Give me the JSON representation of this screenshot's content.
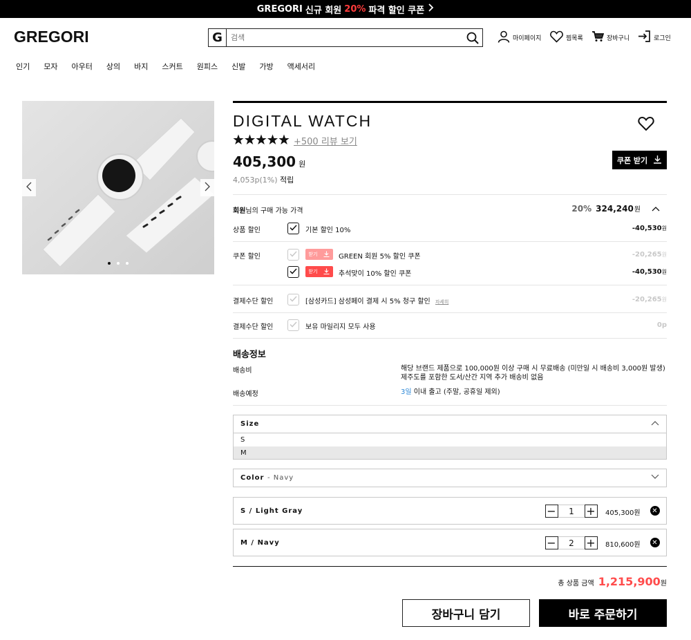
{
  "banner": {
    "brand": "GREGORI",
    "text1": "신규 회원",
    "highlight": "20%",
    "text2": "파격 할인 쿠폰",
    "arrow": ">"
  },
  "header": {
    "logo": "GREGORI",
    "search_badge": "G",
    "search_placeholder": "검색",
    "links": [
      {
        "label": "마이페이지",
        "icon": "user-icon"
      },
      {
        "label": "찜목록",
        "icon": "heart-icon"
      },
      {
        "label": "장바구니",
        "icon": "cart-icon"
      },
      {
        "label": "로그인",
        "icon": "login-icon"
      }
    ]
  },
  "nav": [
    "인기",
    "모자",
    "아우터",
    "상의",
    "바지",
    "스커트",
    "원피스",
    "신발",
    "가방",
    "액세서리"
  ],
  "gallery": {
    "dots": 3,
    "active_dot": 0
  },
  "product": {
    "title": "DIGITAL WATCH",
    "rating": 5,
    "reviews_link": "+500 리뷰 보기",
    "price": "405,300",
    "price_unit": "원",
    "points": "4,053p(1%)",
    "points_suffix": "적립",
    "coupon_button": "쿠폰 받기"
  },
  "member_price": {
    "label_bold": "회원",
    "label_rest": "님의 구매 가능 가격",
    "percent": "20%",
    "price": "324,240",
    "unit": "원"
  },
  "discounts": {
    "product": {
      "label": "상품 할인",
      "desc": "기본 할인 10%",
      "amount": "-40,530",
      "unit": "원"
    },
    "coupon": {
      "label": "쿠폰 할인",
      "tag": "받기",
      "items": [
        {
          "desc": "GREEN 회원 5% 할인 쿠폰",
          "amount": "-20,265",
          "unit": "원",
          "checked": false
        },
        {
          "desc": "추석맞이 10% 할인 쿠폰",
          "amount": "-40,530",
          "unit": "원",
          "checked": true
        }
      ]
    },
    "payment1": {
      "label": "결제수단 할인",
      "desc": "[삼성카드] 삼성페이 결제 시 5% 청구 할인",
      "detail": "자세히",
      "amount": "-20,265",
      "unit": "원"
    },
    "payment2": {
      "label": "결제수단 할인",
      "desc": "보유 마일리지 모두 사용",
      "amount": "0",
      "unit": "p"
    }
  },
  "delivery": {
    "title": "배송정보",
    "fee_label": "배송비",
    "fee_line1": "해당 브랜드 제품으로 100,000원 이상 구매 시 무료배송 (미만일 시 배송비 3,000원 발생)",
    "fee_line2": "제주도를 포함한 도서/산간 지역 추가 배송비 없음",
    "schedule_label": "배송예정",
    "schedule_days": "3일",
    "schedule_text": "이내 출고 (주말, 공휴일 제외)"
  },
  "options": {
    "size_label": "Size",
    "size_options": [
      "S",
      "M"
    ],
    "size_highlighted": "M",
    "color_label": "Color",
    "color_value": "- Navy"
  },
  "cart_items": [
    {
      "name": "S / Light Gray",
      "qty": "1",
      "price": "405,300원"
    },
    {
      "name": "M / Navy",
      "qty": "2",
      "price": "810,600원"
    }
  ],
  "total": {
    "label": "총 상품 금액",
    "value": "1,215,900",
    "unit": "원"
  },
  "actions": {
    "cart": "장바구니 담기",
    "buy": "바로 주문하기"
  }
}
